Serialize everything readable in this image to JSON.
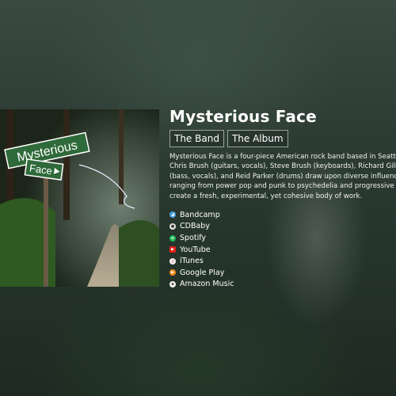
{
  "album": {
    "sign_top": "Mysterious",
    "sign_bottom": "Face"
  },
  "band": {
    "title": "Mysterious Face",
    "tabs": [
      "The Band",
      "The Album"
    ],
    "description_lines": [
      "Mysterious Face is a four-piece American rock band based in Seattle.",
      "Chris Brush (guitars, vocals), Steve Brush (keyboards), Richard Gilbert",
      "(bass, vocals), and Reid Parker (drums) draw upon diverse influences",
      "ranging from power pop and punk to psychedelia and progressive rock to",
      "create a fresh, experimental, yet cohesive body of work."
    ]
  },
  "links": [
    {
      "label": "Bandcamp",
      "icon": "bandcamp-icon",
      "color": "#4aa3df"
    },
    {
      "label": "CDBaby",
      "icon": "cdbaby-icon",
      "color": "#e6e6e6"
    },
    {
      "label": "Spotify",
      "icon": "spotify-icon",
      "color": "#1db954"
    },
    {
      "label": "YouTube",
      "icon": "youtube-icon",
      "color": "#e62117"
    },
    {
      "label": "iTunes",
      "icon": "itunes-icon",
      "color": "#f4f4f4"
    },
    {
      "label": "Google Play",
      "icon": "google-play-icon",
      "color": "#f28b1b"
    },
    {
      "label": "Amazon Music",
      "icon": "amazon-music-icon",
      "color": "#f4f4f4"
    }
  ]
}
